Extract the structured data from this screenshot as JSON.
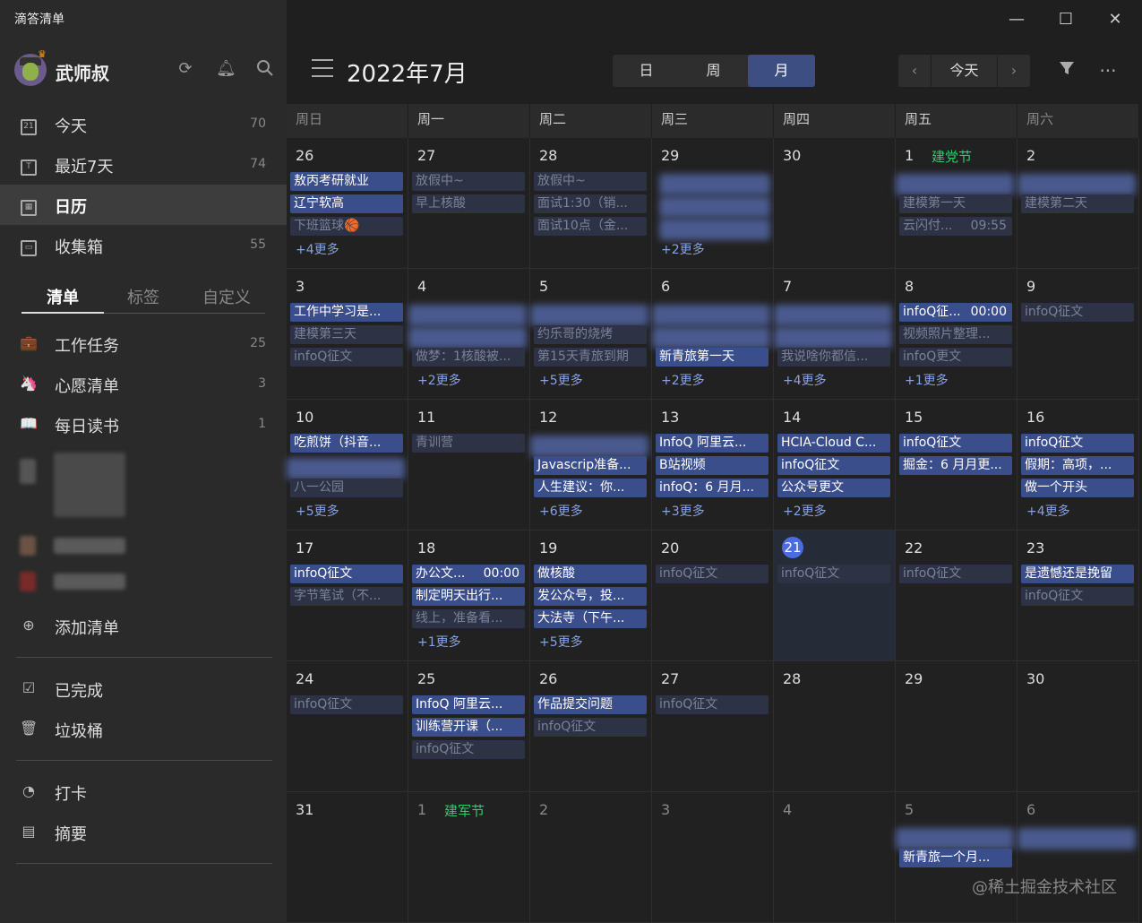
{
  "app_title": "滴答清单",
  "user": {
    "name": "武师叔"
  },
  "nav": [
    {
      "icon": "calendar-today-icon",
      "glyph": "21",
      "label": "今天",
      "count": "70",
      "active": false
    },
    {
      "icon": "calendar-week-icon",
      "glyph": "T",
      "label": "最近7天",
      "count": "74",
      "active": false
    },
    {
      "icon": "calendar-icon",
      "glyph": "▦",
      "label": "日历",
      "count": "",
      "active": true
    },
    {
      "icon": "inbox-icon",
      "glyph": "▭",
      "label": "收集箱",
      "count": "55",
      "active": false
    }
  ],
  "subtabs": [
    "清单",
    "标签",
    "自定义"
  ],
  "lists": [
    {
      "icon": "briefcase-icon",
      "glyph": "💼",
      "label": "工作任务",
      "count": "25"
    },
    {
      "icon": "unicorn-icon",
      "glyph": "🦄",
      "label": "心愿清单",
      "count": "3"
    },
    {
      "icon": "book-icon",
      "glyph": "📖",
      "label": "每日读书",
      "count": "1"
    }
  ],
  "add_list": "添加清单",
  "completed": "已完成",
  "trash": "垃圾桶",
  "checkin": "打卡",
  "summary": "摘要",
  "header": {
    "month_title": "2022年7月",
    "views": [
      "日",
      "周",
      "月"
    ],
    "active_view": 2,
    "today": "今天"
  },
  "weekdays": [
    "周日",
    "周一",
    "周二",
    "周三",
    "周四",
    "周五",
    "周六"
  ],
  "weeks": [
    [
      {
        "d": "26",
        "events": [
          {
            "t": "敖丙考研就业",
            "s": "b"
          },
          {
            "t": "辽宁软高",
            "s": "b"
          },
          {
            "t": "下班篮球🏀",
            "s": "d"
          }
        ],
        "more": "+4更多"
      },
      {
        "d": "27",
        "events": [
          {
            "t": "放假中~",
            "s": "d"
          },
          {
            "t": "早上核酸",
            "s": "d"
          }
        ]
      },
      {
        "d": "28",
        "events": [
          {
            "t": "放假中~",
            "s": "d"
          },
          {
            "t": "面试1:30（销...",
            "s": "d"
          },
          {
            "t": "面试10点（金...",
            "s": "d"
          }
        ]
      },
      {
        "d": "29",
        "blur": [
          0,
          1,
          2
        ],
        "more": "+2更多"
      },
      {
        "d": "30"
      },
      {
        "d": "1",
        "holiday": "建党节",
        "blurtop": true,
        "events": [
          {
            "t": "",
            "s": "b",
            "blur": true
          },
          {
            "t": "建模第一天",
            "s": "d"
          },
          {
            "t": "云闪付...",
            "s": "d",
            "time": "09:55"
          }
        ]
      },
      {
        "d": "2",
        "blurtop": true,
        "events": [
          {
            "t": "",
            "s": "b",
            "blur": true
          },
          {
            "t": "建模第二天",
            "s": "d"
          }
        ]
      }
    ],
    [
      {
        "d": "3",
        "events": [
          {
            "t": "工作中学习是...",
            "s": "b"
          },
          {
            "t": "建模第三天",
            "s": "d"
          },
          {
            "t": "infoQ征文",
            "s": "d"
          }
        ]
      },
      {
        "d": "4",
        "events": [
          {
            "t": "吃烤串遇",
            "s": "d",
            "blur": true
          },
          {
            "t": "",
            "s": "d",
            "blur": true
          },
          {
            "t": "做梦：1核酸被...",
            "s": "d"
          }
        ],
        "more": "+2更多"
      },
      {
        "d": "5",
        "events": [
          {
            "t": "",
            "s": "d",
            "blur": true
          },
          {
            "t": "约乐哥的烧烤",
            "s": "d"
          },
          {
            "t": "第15天青旅到期",
            "s": "d"
          }
        ],
        "more": "+5更多"
      },
      {
        "d": "6",
        "events": [
          {
            "t": "",
            "s": "b",
            "blur": true
          },
          {
            "t": "",
            "s": "b",
            "blur": true
          },
          {
            "t": "新青旅第一天",
            "s": "b"
          }
        ],
        "more": "+2更多"
      },
      {
        "d": "7",
        "events": [
          {
            "t": "",
            "s": "d",
            "blur": true
          },
          {
            "t": "",
            "s": "d",
            "blur": true
          },
          {
            "t": "我说啥你都信...",
            "s": "d"
          }
        ],
        "more": "+4更多"
      },
      {
        "d": "8",
        "events": [
          {
            "t": "infoQ征...",
            "s": "b",
            "time": "00:00"
          },
          {
            "t": "视频照片整理...",
            "s": "d"
          },
          {
            "t": "infoQ更文",
            "s": "d"
          }
        ],
        "more": "+1更多"
      },
      {
        "d": "9",
        "events": [
          {
            "t": "infoQ征文",
            "s": "d"
          }
        ]
      }
    ],
    [
      {
        "d": "10",
        "events": [
          {
            "t": "吃煎饼（抖音...",
            "s": "b"
          },
          {
            "t": "",
            "s": "b",
            "blur": true
          },
          {
            "t": "八一公园",
            "s": "d"
          }
        ],
        "more": "+5更多"
      },
      {
        "d": "11",
        "events": [
          {
            "t": "青训营",
            "s": "d"
          }
        ]
      },
      {
        "d": "12",
        "events": [
          {
            "t": "",
            "s": "b",
            "blur": true
          },
          {
            "t": "Javascrip准备...",
            "s": "b"
          },
          {
            "t": "人生建议：你...",
            "s": "b"
          }
        ],
        "more": "+6更多"
      },
      {
        "d": "13",
        "events": [
          {
            "t": "InfoQ 阿里云...",
            "s": "b"
          },
          {
            "t": "B站视频",
            "s": "b"
          },
          {
            "t": "infoQ：6 月月...",
            "s": "b"
          }
        ],
        "more": "+3更多"
      },
      {
        "d": "14",
        "events": [
          {
            "t": "HCIA-Cloud C...",
            "s": "b"
          },
          {
            "t": "infoQ征文",
            "s": "b"
          },
          {
            "t": "公众号更文",
            "s": "b"
          }
        ],
        "more": "+2更多"
      },
      {
        "d": "15",
        "events": [
          {
            "t": "infoQ征文",
            "s": "b"
          },
          {
            "t": "掘金：6 月月更...",
            "s": "b"
          }
        ]
      },
      {
        "d": "16",
        "events": [
          {
            "t": "infoQ征文",
            "s": "b"
          },
          {
            "t": "假期：高项，...",
            "s": "b"
          },
          {
            "t": "做一个开头",
            "s": "b"
          }
        ],
        "more": "+4更多"
      }
    ],
    [
      {
        "d": "17",
        "events": [
          {
            "t": "infoQ征文",
            "s": "b"
          },
          {
            "t": "字节笔试（不...",
            "s": "d"
          }
        ]
      },
      {
        "d": "18",
        "events": [
          {
            "t": "办公文...",
            "s": "b",
            "time": "00:00"
          },
          {
            "t": "制定明天出行...",
            "s": "b"
          },
          {
            "t": "线上，准备看...",
            "s": "d"
          }
        ],
        "more": "+1更多"
      },
      {
        "d": "19",
        "events": [
          {
            "t": "做核酸",
            "s": "b"
          },
          {
            "t": "发公众号，投...",
            "s": "b"
          },
          {
            "t": "大法寺（下午...",
            "s": "b"
          }
        ],
        "more": "+5更多"
      },
      {
        "d": "20",
        "events": [
          {
            "t": "infoQ征文",
            "s": "d"
          }
        ]
      },
      {
        "d": "21",
        "today": true,
        "events": [
          {
            "t": "infoQ征文",
            "s": "d"
          }
        ]
      },
      {
        "d": "22",
        "events": [
          {
            "t": "infoQ征文",
            "s": "d"
          }
        ]
      },
      {
        "d": "23",
        "events": [
          {
            "t": "是遗憾还是挽留",
            "s": "b"
          },
          {
            "t": "infoQ征文",
            "s": "d"
          }
        ]
      }
    ],
    [
      {
        "d": "24",
        "events": [
          {
            "t": "infoQ征文",
            "s": "d"
          }
        ]
      },
      {
        "d": "25",
        "events": [
          {
            "t": "InfoQ 阿里云...",
            "s": "b"
          },
          {
            "t": "训练营开课（...",
            "s": "b"
          },
          {
            "t": "infoQ征文",
            "s": "d"
          }
        ]
      },
      {
        "d": "26",
        "events": [
          {
            "t": "作品提交问题",
            "s": "b"
          },
          {
            "t": "infoQ征文",
            "s": "d"
          }
        ]
      },
      {
        "d": "27",
        "events": [
          {
            "t": "infoQ征文",
            "s": "d"
          }
        ]
      },
      {
        "d": "28"
      },
      {
        "d": "29"
      },
      {
        "d": "30"
      }
    ],
    [
      {
        "d": "31"
      },
      {
        "d": "1",
        "dim": true,
        "holiday": "建军节"
      },
      {
        "d": "2",
        "dim": true
      },
      {
        "d": "3",
        "dim": true
      },
      {
        "d": "4",
        "dim": true
      },
      {
        "d": "5",
        "dim": true,
        "blurtop": true,
        "events": [
          {
            "t": "",
            "s": "b",
            "blur": true
          },
          {
            "t": "新青旅一个月...",
            "s": "b"
          }
        ]
      },
      {
        "d": "6",
        "dim": true,
        "blurtop": true,
        "events": [
          {
            "t": "",
            "s": "b",
            "blur": true
          }
        ]
      }
    ]
  ],
  "watermark": "@稀土掘金技术社区",
  "colors": {
    "accent": "#3b4e8c",
    "today": "#4b6be0",
    "holiday": "#2ecc71"
  }
}
